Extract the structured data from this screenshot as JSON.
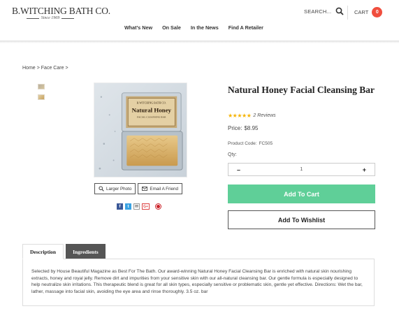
{
  "header": {
    "logo_main": "B.WITCHING BATH CO.",
    "logo_sub": "Since 1969",
    "search_label": "SEARCH...",
    "search_icon": "search-icon",
    "cart_label": "CART",
    "cart_count": "0",
    "colors": {
      "cart_badge": "#f04e3e"
    }
  },
  "nav": {
    "items": [
      "What's New",
      "On Sale",
      "In the News",
      "Find A Retailer"
    ]
  },
  "breadcrumb": {
    "items": [
      "Home",
      ">",
      "Face Care",
      ">"
    ]
  },
  "product": {
    "image_label_line1": "B.WITCHING BATH CO.",
    "image_label_line2": "Natural Honey",
    "image_label_line3": "FACIAL CLEANSING BAR",
    "larger_photo": "Larger Photo",
    "email_friend": "Email A Friend",
    "share": {
      "facebook": "f",
      "twitter": "t",
      "email": "✉",
      "google": "G+",
      "pinterest": "p"
    },
    "title": "Natural Honey Facial Cleansing Bar",
    "stars": "★★★★★",
    "rating": 5,
    "reviews": "2 Reviews",
    "price_label": "Price:",
    "price": "$8.95",
    "code_label": "Product Code:",
    "code": "FC505",
    "qty_label": "Qty:",
    "qty_minus": "–",
    "qty_value": "1",
    "qty_plus": "+",
    "add_to_cart": "Add To Cart",
    "add_to_wishlist": "Add To Wishlist",
    "colors": {
      "add_to_cart": "#5fcf98",
      "stars": "#f5b301"
    }
  },
  "tabs": {
    "items": [
      {
        "label": "Description",
        "active": true
      },
      {
        "label": "Ingredients",
        "active": false
      }
    ],
    "description": "Selected by House Beautiful Magazine as Best For The Bath. Our award-winning Natural Honey Facial Cleansing Bar is enriched with natural skin nourishing extracts, honey and royal jelly.  Remove dirt and impurities from your sensitive skin with our all-natural cleansing bar. Our gentle formula is especially designed to help neutralize skin irritations. This therapeutic blend is great for all skin types, especially sensitive or problematic skin, gentle yet effective. Directions: Wet the bar, lather, massage into facial skin, avoiding the eye area and rinse thoroughly.  3.5 oz. bar"
  }
}
